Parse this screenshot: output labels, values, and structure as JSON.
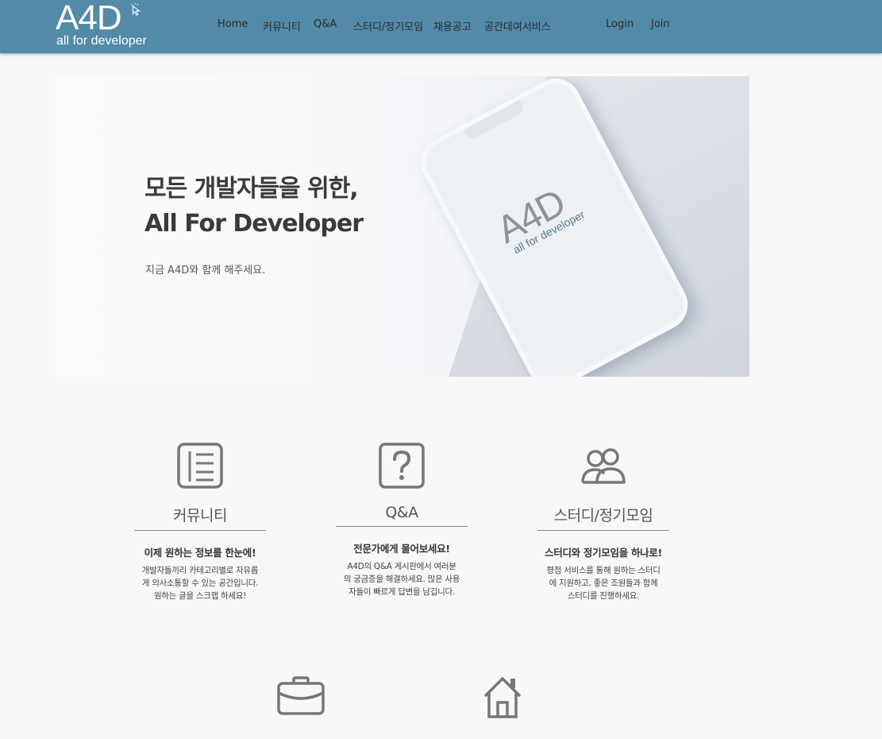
{
  "header": {
    "logo_main": "A4D",
    "logo_sub": "all for developer",
    "nav": [
      "Home",
      "커뮤니티",
      "Q&A",
      "스터디/정기모임",
      "채용공고",
      "공간대여서비스"
    ],
    "auth": [
      "Login",
      "Join"
    ],
    "background_color": "#528aa8"
  },
  "hero": {
    "title_line1": "모든 개발자들을 위한,",
    "title_line2": "All For Developer",
    "subtitle": "지금 A4D와 함께 해주세요.",
    "phone_logo": "A4D",
    "phone_logo_sub": "all for developer"
  },
  "features": [
    {
      "icon": "list-document-icon",
      "title": "커뮤니티",
      "headline": "이제 원하는 정보를 한눈에!",
      "desc": [
        "개발자들끼리 카테고리별로 자유롭",
        "게 의사소통할 수 있는 공간입니다.",
        "원하는 글을 스크랩 하세요!"
      ]
    },
    {
      "icon": "question-icon",
      "title": "Q&A",
      "headline": "전문가에게 물어보세요!",
      "desc": [
        "A4D의 Q&A 게시판에서 여러분",
        "의 궁금증을 해결하세요. 많은 사용",
        "자들이 빠르게 답변을 남깁니다."
      ]
    },
    {
      "icon": "users-icon",
      "title": "스터디/정기모임",
      "headline": "스터디와 정기모임을 하나로!",
      "desc": [
        "평점 서비스를 통해 원하는 스터디",
        "에 지원하고, 좋은 조원들과 함께",
        "스터디를 진행하세요."
      ]
    },
    {
      "icon": "briefcase-icon"
    },
    {
      "icon": "house-icon"
    }
  ]
}
